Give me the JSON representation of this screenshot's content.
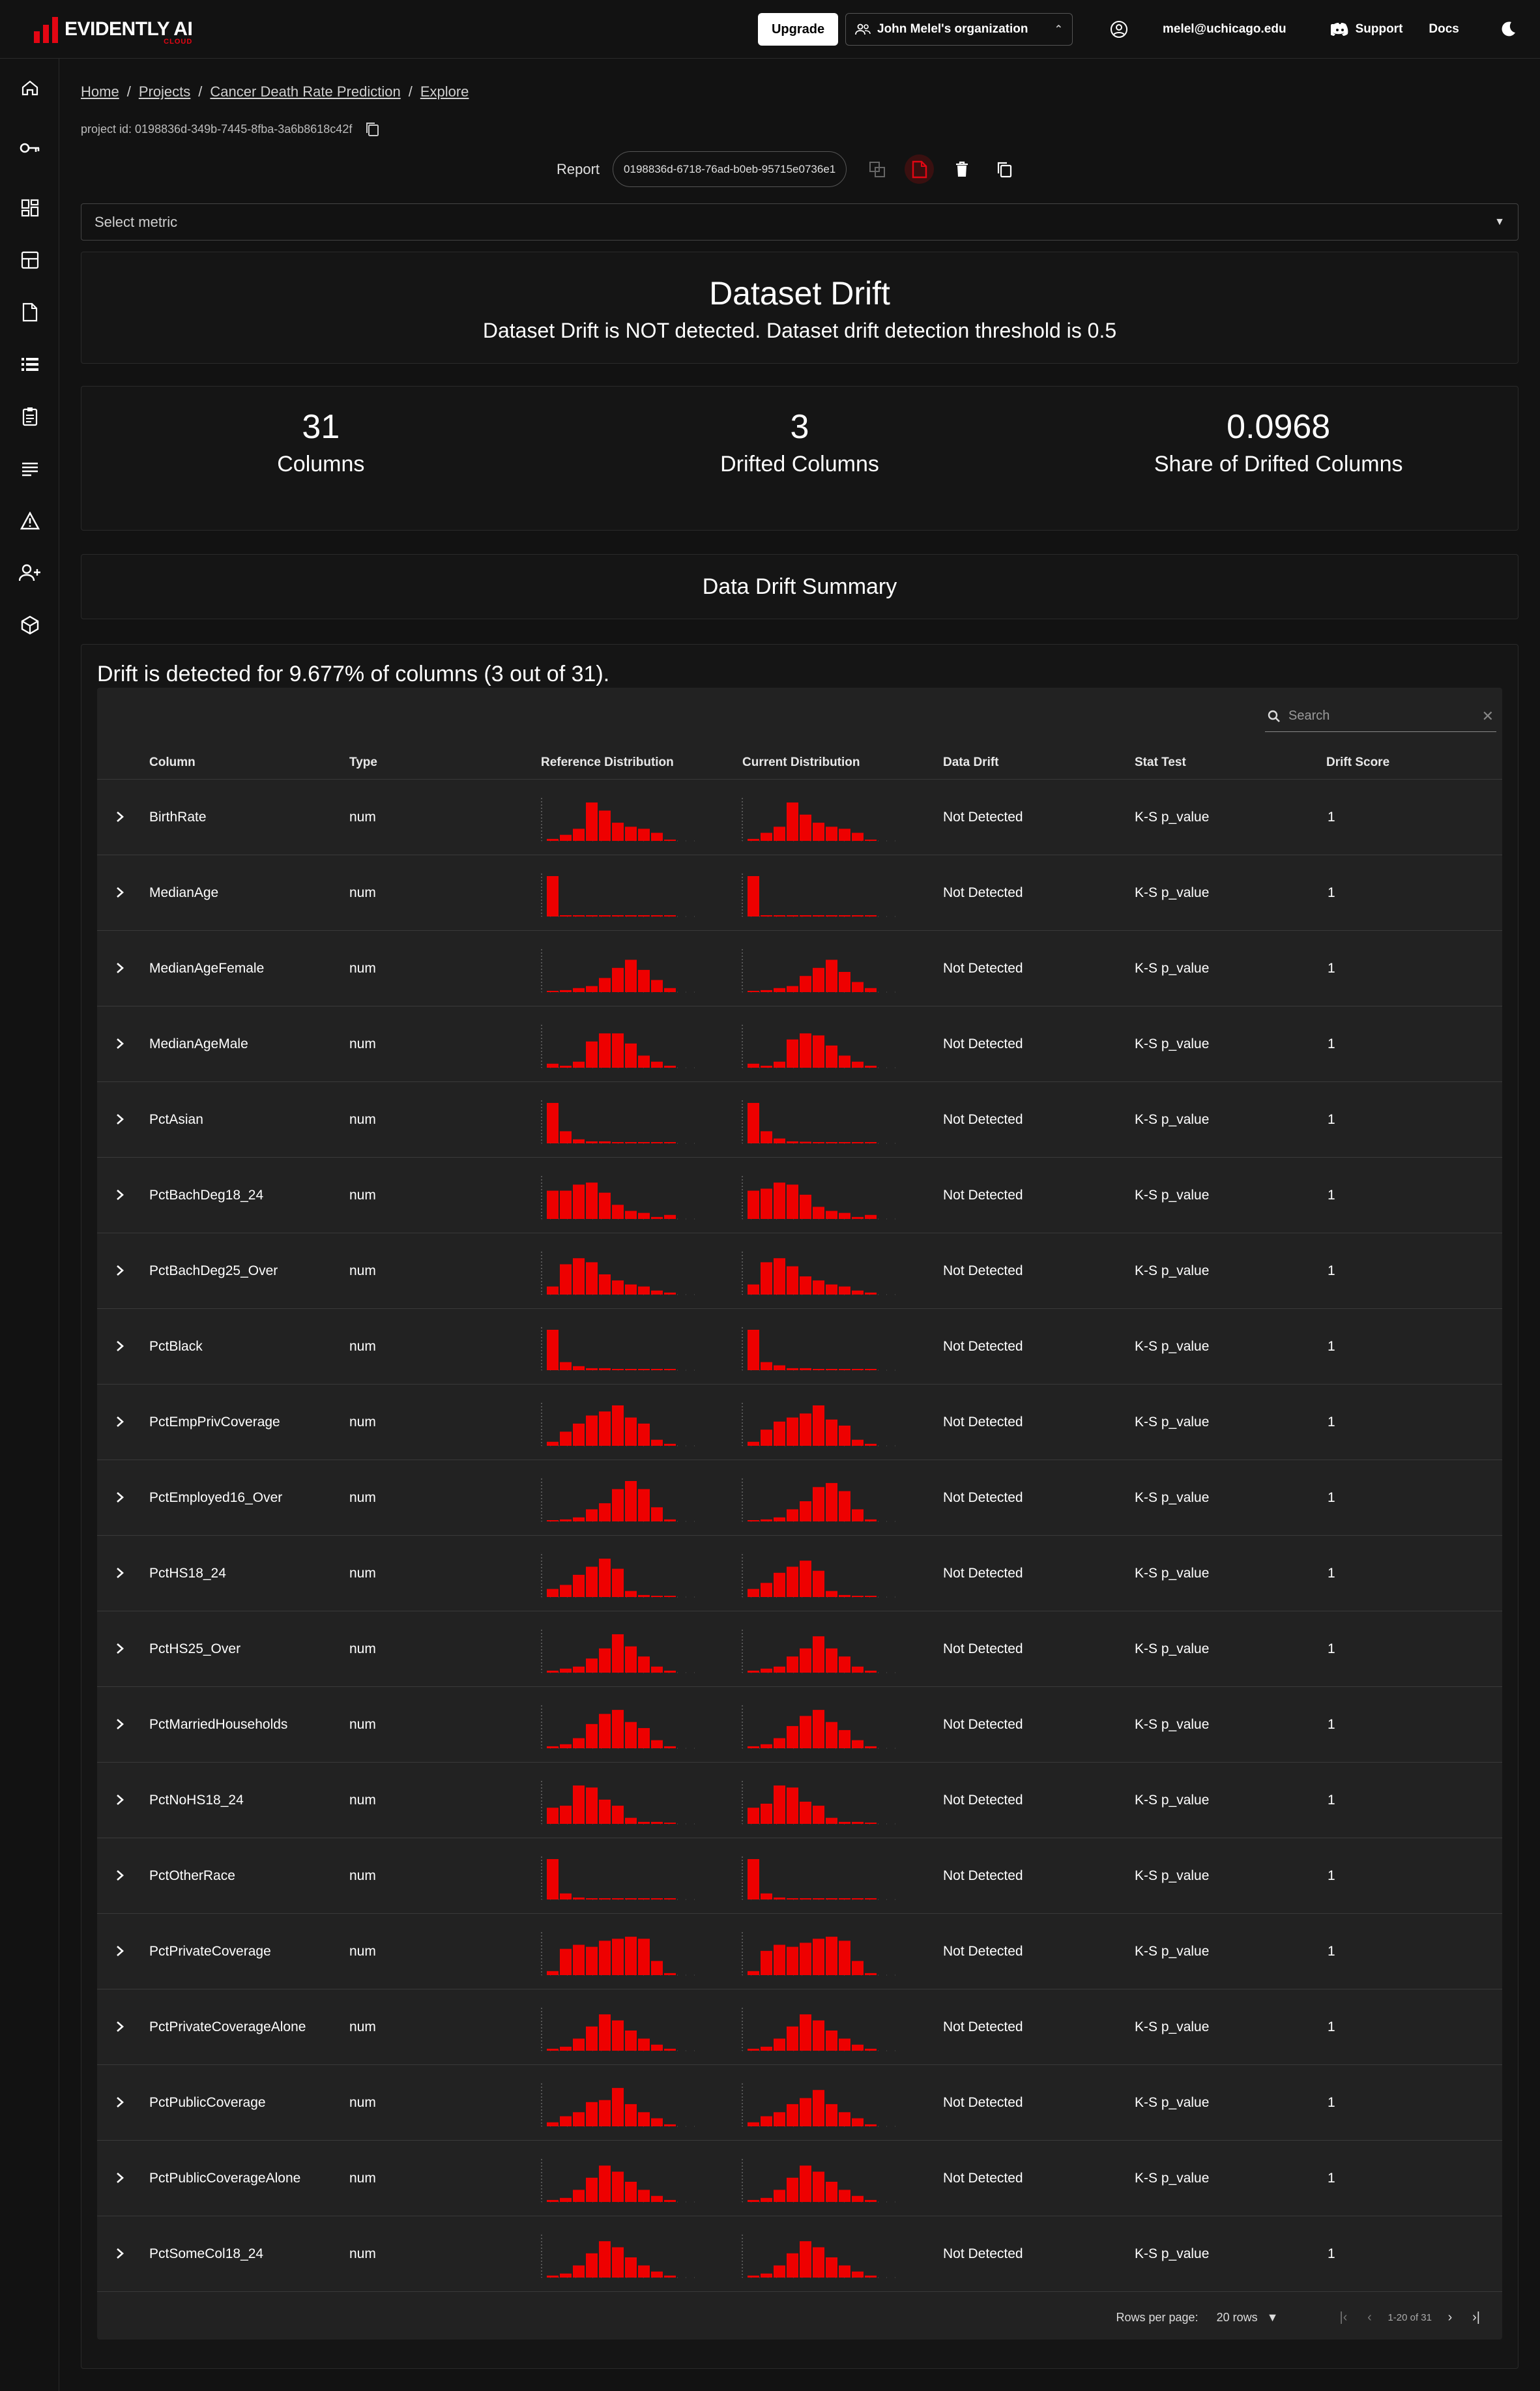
{
  "header": {
    "logo_text": "EVIDENTLY AI",
    "logo_sub": "CLOUD",
    "upgrade_label": "Upgrade",
    "org_name": "John Melel's organization",
    "user_email": "melel@uchicago.edu",
    "support_label": "Support",
    "docs_label": "Docs"
  },
  "sidebar": {
    "items": [
      "home-icon",
      "key-icon",
      "dashboard-icon",
      "panels-icon",
      "report-icon",
      "list-icon",
      "clipboard-icon",
      "text-lines-icon",
      "alert-icon",
      "add-user-icon",
      "cube-icon"
    ]
  },
  "breadcrumb": [
    "Home",
    "Projects",
    "Cancer Death Rate Prediction",
    "Explore"
  ],
  "project_id_text": "project id: 0198836d-349b-7445-8fba-3a6b8618c42f",
  "report": {
    "label": "Report",
    "id": "0198836d-6718-76ad-b0eb-95715e0736e1"
  },
  "select_metric_placeholder": "Select metric",
  "dataset_drift": {
    "title": "Dataset Drift",
    "subtitle": "Dataset Drift is NOT detected. Dataset drift detection threshold is 0.5"
  },
  "counters": [
    {
      "value": "31",
      "label": "Columns"
    },
    {
      "value": "3",
      "label": "Drifted Columns"
    },
    {
      "value": "0.0968",
      "label": "Share of Drifted Columns"
    }
  ],
  "summary_title": "Data Drift Summary",
  "table": {
    "heading": "Drift is detected for 9.677% of columns (3 out of 31).",
    "search_placeholder": "Search",
    "columns": [
      "Column",
      "Type",
      "Reference Distribution",
      "Current Distribution",
      "Data Drift",
      "Stat Test",
      "Drift Score"
    ],
    "rows": [
      {
        "name": "BirthRate",
        "type": "num",
        "drift": "Not Detected",
        "test": "K-S p_value",
        "score": "1"
      },
      {
        "name": "MedianAge",
        "type": "num",
        "drift": "Not Detected",
        "test": "K-S p_value",
        "score": "1"
      },
      {
        "name": "MedianAgeFemale",
        "type": "num",
        "drift": "Not Detected",
        "test": "K-S p_value",
        "score": "1"
      },
      {
        "name": "MedianAgeMale",
        "type": "num",
        "drift": "Not Detected",
        "test": "K-S p_value",
        "score": "1"
      },
      {
        "name": "PctAsian",
        "type": "num",
        "drift": "Not Detected",
        "test": "K-S p_value",
        "score": "1"
      },
      {
        "name": "PctBachDeg18_24",
        "type": "num",
        "drift": "Not Detected",
        "test": "K-S p_value",
        "score": "1"
      },
      {
        "name": "PctBachDeg25_Over",
        "type": "num",
        "drift": "Not Detected",
        "test": "K-S p_value",
        "score": "1"
      },
      {
        "name": "PctBlack",
        "type": "num",
        "drift": "Not Detected",
        "test": "K-S p_value",
        "score": "1"
      },
      {
        "name": "PctEmpPrivCoverage",
        "type": "num",
        "drift": "Not Detected",
        "test": "K-S p_value",
        "score": "1"
      },
      {
        "name": "PctEmployed16_Over",
        "type": "num",
        "drift": "Not Detected",
        "test": "K-S p_value",
        "score": "1"
      },
      {
        "name": "PctHS18_24",
        "type": "num",
        "drift": "Not Detected",
        "test": "K-S p_value",
        "score": "1"
      },
      {
        "name": "PctHS25_Over",
        "type": "num",
        "drift": "Not Detected",
        "test": "K-S p_value",
        "score": "1"
      },
      {
        "name": "PctMarriedHouseholds",
        "type": "num",
        "drift": "Not Detected",
        "test": "K-S p_value",
        "score": "1"
      },
      {
        "name": "PctNoHS18_24",
        "type": "num",
        "drift": "Not Detected",
        "test": "K-S p_value",
        "score": "1"
      },
      {
        "name": "PctOtherRace",
        "type": "num",
        "drift": "Not Detected",
        "test": "K-S p_value",
        "score": "1"
      },
      {
        "name": "PctPrivateCoverage",
        "type": "num",
        "drift": "Not Detected",
        "test": "K-S p_value",
        "score": "1"
      },
      {
        "name": "PctPrivateCoverageAlone",
        "type": "num",
        "drift": "Not Detected",
        "test": "K-S p_value",
        "score": "1"
      },
      {
        "name": "PctPublicCoverage",
        "type": "num",
        "drift": "Not Detected",
        "test": "K-S p_value",
        "score": "1"
      },
      {
        "name": "PctPublicCoverageAlone",
        "type": "num",
        "drift": "Not Detected",
        "test": "K-S p_value",
        "score": "1"
      },
      {
        "name": "PctSomeCol18_24",
        "type": "num",
        "drift": "Not Detected",
        "test": "K-S p_value",
        "score": "1"
      }
    ],
    "rows_per_page_label": "Rows per page:",
    "rows_per_page_value": "20 rows",
    "page_info": "1-20 of 31"
  },
  "chart_data": {
    "type": "bar",
    "description_series": "sparkline histograms per row: reference and current distributions (relative bin heights 0-1)",
    "series": [
      {
        "name": "BirthRate",
        "reference": [
          0.05,
          0.15,
          0.3,
          0.95,
          0.75,
          0.45,
          0.35,
          0.3,
          0.2,
          0.02
        ],
        "current": [
          0.05,
          0.2,
          0.35,
          0.95,
          0.65,
          0.45,
          0.35,
          0.3,
          0.2,
          0.02
        ]
      },
      {
        "name": "MedianAge",
        "reference": [
          1.0,
          0.02,
          0.02,
          0.02,
          0.01,
          0.01,
          0.01,
          0.01,
          0.01,
          0.01
        ],
        "current": [
          1.0,
          0.02,
          0.02,
          0.02,
          0.01,
          0.01,
          0.01,
          0.01,
          0.01,
          0.01
        ]
      },
      {
        "name": "MedianAgeFemale",
        "reference": [
          0.02,
          0.05,
          0.1,
          0.15,
          0.35,
          0.6,
          0.8,
          0.55,
          0.3,
          0.1
        ],
        "current": [
          0.02,
          0.05,
          0.1,
          0.15,
          0.4,
          0.6,
          0.8,
          0.5,
          0.25,
          0.1
        ]
      },
      {
        "name": "MedianAgeMale",
        "reference": [
          0.1,
          0.05,
          0.15,
          0.65,
          0.85,
          0.85,
          0.6,
          0.3,
          0.15,
          0.05
        ],
        "current": [
          0.1,
          0.05,
          0.15,
          0.7,
          0.85,
          0.8,
          0.55,
          0.3,
          0.15,
          0.05
        ]
      },
      {
        "name": "PctAsian",
        "reference": [
          1.0,
          0.3,
          0.1,
          0.05,
          0.05,
          0.02,
          0.02,
          0.02,
          0.01,
          0.01
        ],
        "current": [
          1.0,
          0.3,
          0.12,
          0.05,
          0.04,
          0.03,
          0.02,
          0.02,
          0.01,
          0.01
        ]
      },
      {
        "name": "PctBachDeg18_24",
        "reference": [
          0.7,
          0.7,
          0.85,
          0.9,
          0.65,
          0.35,
          0.2,
          0.15,
          0.05,
          0.1
        ],
        "current": [
          0.7,
          0.75,
          0.9,
          0.85,
          0.6,
          0.3,
          0.2,
          0.15,
          0.05,
          0.1
        ]
      },
      {
        "name": "PctBachDeg25_Over",
        "reference": [
          0.2,
          0.75,
          0.9,
          0.8,
          0.5,
          0.35,
          0.25,
          0.2,
          0.1,
          0.05
        ],
        "current": [
          0.25,
          0.8,
          0.9,
          0.7,
          0.45,
          0.35,
          0.25,
          0.2,
          0.1,
          0.05
        ]
      },
      {
        "name": "PctBlack",
        "reference": [
          1.0,
          0.2,
          0.1,
          0.05,
          0.05,
          0.03,
          0.02,
          0.02,
          0.01,
          0.01
        ],
        "current": [
          1.0,
          0.2,
          0.12,
          0.05,
          0.05,
          0.03,
          0.02,
          0.02,
          0.01,
          0.01
        ]
      },
      {
        "name": "PctEmpPrivCoverage",
        "reference": [
          0.1,
          0.35,
          0.55,
          0.75,
          0.85,
          1.0,
          0.7,
          0.55,
          0.15,
          0.05
        ],
        "current": [
          0.1,
          0.4,
          0.6,
          0.7,
          0.8,
          1.0,
          0.65,
          0.5,
          0.15,
          0.05
        ]
      },
      {
        "name": "PctEmployed16_Over",
        "reference": [
          0.02,
          0.05,
          0.1,
          0.3,
          0.45,
          0.8,
          1.0,
          0.8,
          0.35,
          0.05
        ],
        "current": [
          0.02,
          0.05,
          0.1,
          0.3,
          0.5,
          0.85,
          0.95,
          0.75,
          0.3,
          0.05
        ]
      },
      {
        "name": "PctHS18_24",
        "reference": [
          0.2,
          0.3,
          0.55,
          0.75,
          0.95,
          0.7,
          0.15,
          0.05,
          0.02,
          0.02
        ],
        "current": [
          0.2,
          0.35,
          0.6,
          0.75,
          0.9,
          0.65,
          0.15,
          0.05,
          0.02,
          0.02
        ]
      },
      {
        "name": "PctHS25_Over",
        "reference": [
          0.05,
          0.1,
          0.15,
          0.35,
          0.6,
          0.95,
          0.65,
          0.4,
          0.15,
          0.05
        ],
        "current": [
          0.05,
          0.1,
          0.15,
          0.4,
          0.6,
          0.9,
          0.6,
          0.4,
          0.15,
          0.05
        ]
      },
      {
        "name": "PctMarriedHouseholds",
        "reference": [
          0.05,
          0.1,
          0.25,
          0.6,
          0.85,
          0.95,
          0.65,
          0.5,
          0.2,
          0.05
        ],
        "current": [
          0.05,
          0.1,
          0.25,
          0.55,
          0.8,
          0.95,
          0.65,
          0.45,
          0.2,
          0.05
        ]
      },
      {
        "name": "PctNoHS18_24",
        "reference": [
          0.4,
          0.45,
          0.95,
          0.9,
          0.6,
          0.45,
          0.15,
          0.05,
          0.05,
          0.02
        ],
        "current": [
          0.4,
          0.5,
          0.95,
          0.9,
          0.55,
          0.45,
          0.15,
          0.05,
          0.05,
          0.02
        ]
      },
      {
        "name": "PctOtherRace",
        "reference": [
          1.0,
          0.15,
          0.05,
          0.03,
          0.02,
          0.02,
          0.01,
          0.01,
          0.01,
          0.01
        ],
        "current": [
          1.0,
          0.15,
          0.05,
          0.03,
          0.02,
          0.02,
          0.01,
          0.01,
          0.01,
          0.01
        ]
      },
      {
        "name": "PctPrivateCoverage",
        "reference": [
          0.1,
          0.65,
          0.75,
          0.7,
          0.85,
          0.9,
          0.95,
          0.9,
          0.35,
          0.05
        ],
        "current": [
          0.1,
          0.6,
          0.75,
          0.7,
          0.8,
          0.9,
          0.95,
          0.85,
          0.35,
          0.05
        ]
      },
      {
        "name": "PctPublicCoverage",
        "reference": [
          0.1,
          0.25,
          0.35,
          0.6,
          0.65,
          0.95,
          0.55,
          0.35,
          0.2,
          0.05
        ],
        "current": [
          0.1,
          0.25,
          0.35,
          0.55,
          0.7,
          0.9,
          0.55,
          0.35,
          0.2,
          0.05
        ]
      }
    ]
  }
}
